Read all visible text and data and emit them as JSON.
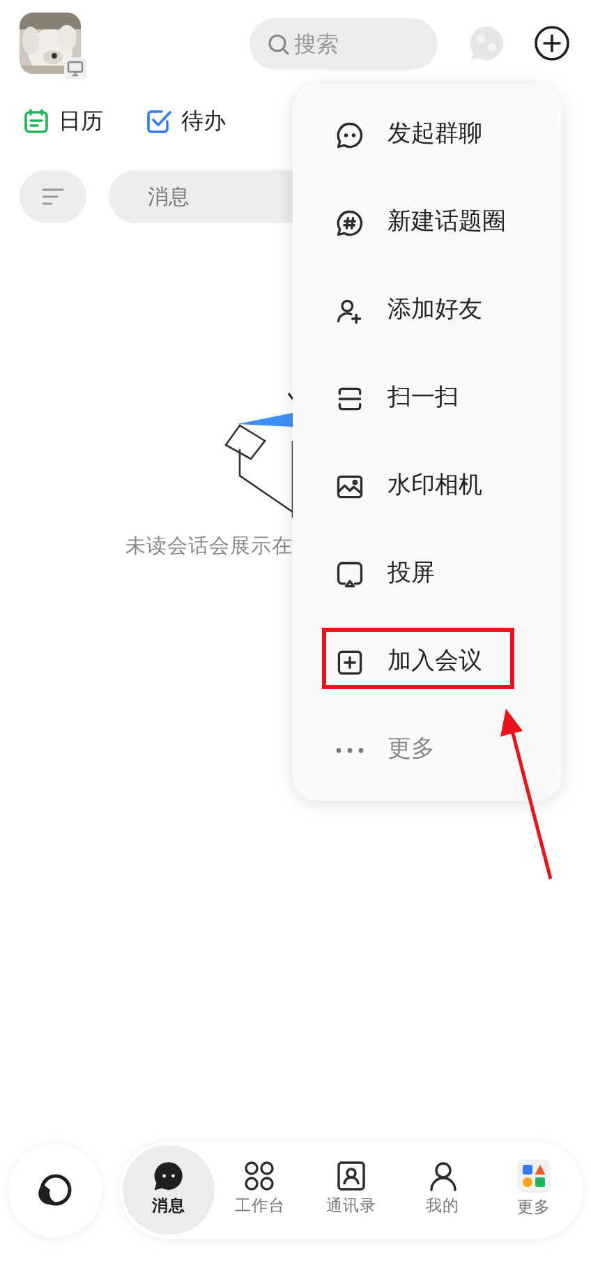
{
  "header": {
    "search": {
      "placeholder": "搜索"
    }
  },
  "quick_links": [
    {
      "label": "日历",
      "kind": "calendar"
    },
    {
      "label": "待办",
      "kind": "todo"
    }
  ],
  "filter_tabs": [
    {
      "label": "消息"
    }
  ],
  "empty_state": {
    "text": "未读会话会展示在"
  },
  "menu": {
    "items": [
      {
        "label": "发起群聊",
        "kind": "chat",
        "highlighted": false
      },
      {
        "label": "新建话题圈",
        "kind": "topic",
        "highlighted": false
      },
      {
        "label": "添加好友",
        "kind": "add-friend",
        "highlighted": false
      },
      {
        "label": "扫一扫",
        "kind": "scan",
        "highlighted": false
      },
      {
        "label": "水印相机",
        "kind": "camera",
        "highlighted": false
      },
      {
        "label": "投屏",
        "kind": "screen",
        "highlighted": false
      },
      {
        "label": "加入会议",
        "kind": "meeting",
        "highlighted": true
      },
      {
        "label": "更多",
        "kind": "more",
        "highlighted": false
      }
    ]
  },
  "bottom_nav": [
    {
      "label": "消息",
      "kind": "messages",
      "selected": true
    },
    {
      "label": "工作台",
      "kind": "workbench",
      "selected": false
    },
    {
      "label": "通讯录",
      "kind": "contacts",
      "selected": false
    },
    {
      "label": "我的",
      "kind": "me",
      "selected": false
    },
    {
      "label": "更多",
      "kind": "more",
      "selected": false
    }
  ]
}
